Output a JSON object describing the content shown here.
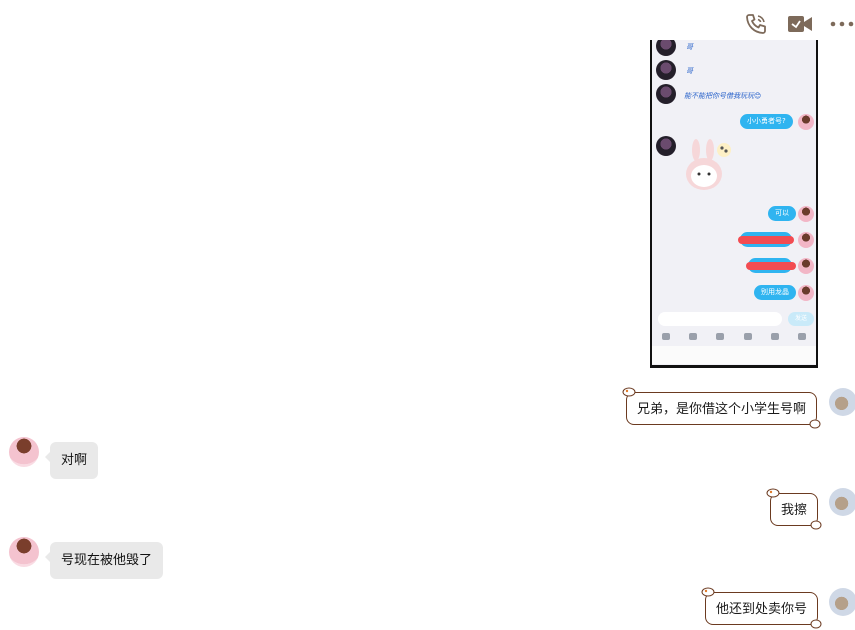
{
  "toolbar": {
    "icons": [
      "phone-icon",
      "video-call-icon",
      "more-icon"
    ],
    "icon_color": "#7d6a5a"
  },
  "phone_screenshot": {
    "top_msgs": [
      "哥",
      "哥",
      "能不能把你号借我玩玩😊"
    ],
    "right_bubbles": [
      "小小勇者号?",
      "可以",
      "别用龙晶"
    ],
    "send_label": "发送"
  },
  "messages": [
    {
      "side": "right",
      "text": "兄弟，是你借这个小学生号啊"
    },
    {
      "side": "left",
      "text": "对啊"
    },
    {
      "side": "right",
      "text": "我擦"
    },
    {
      "side": "left",
      "text": "号现在被他毁了"
    },
    {
      "side": "right",
      "text": "他还到处卖你号"
    }
  ],
  "colors": {
    "left_bubble": "#e9e9e9",
    "right_bubble_border": "#6b3a20",
    "mini_bubble": "#2fb4f0",
    "scribble": "#f24c52"
  }
}
